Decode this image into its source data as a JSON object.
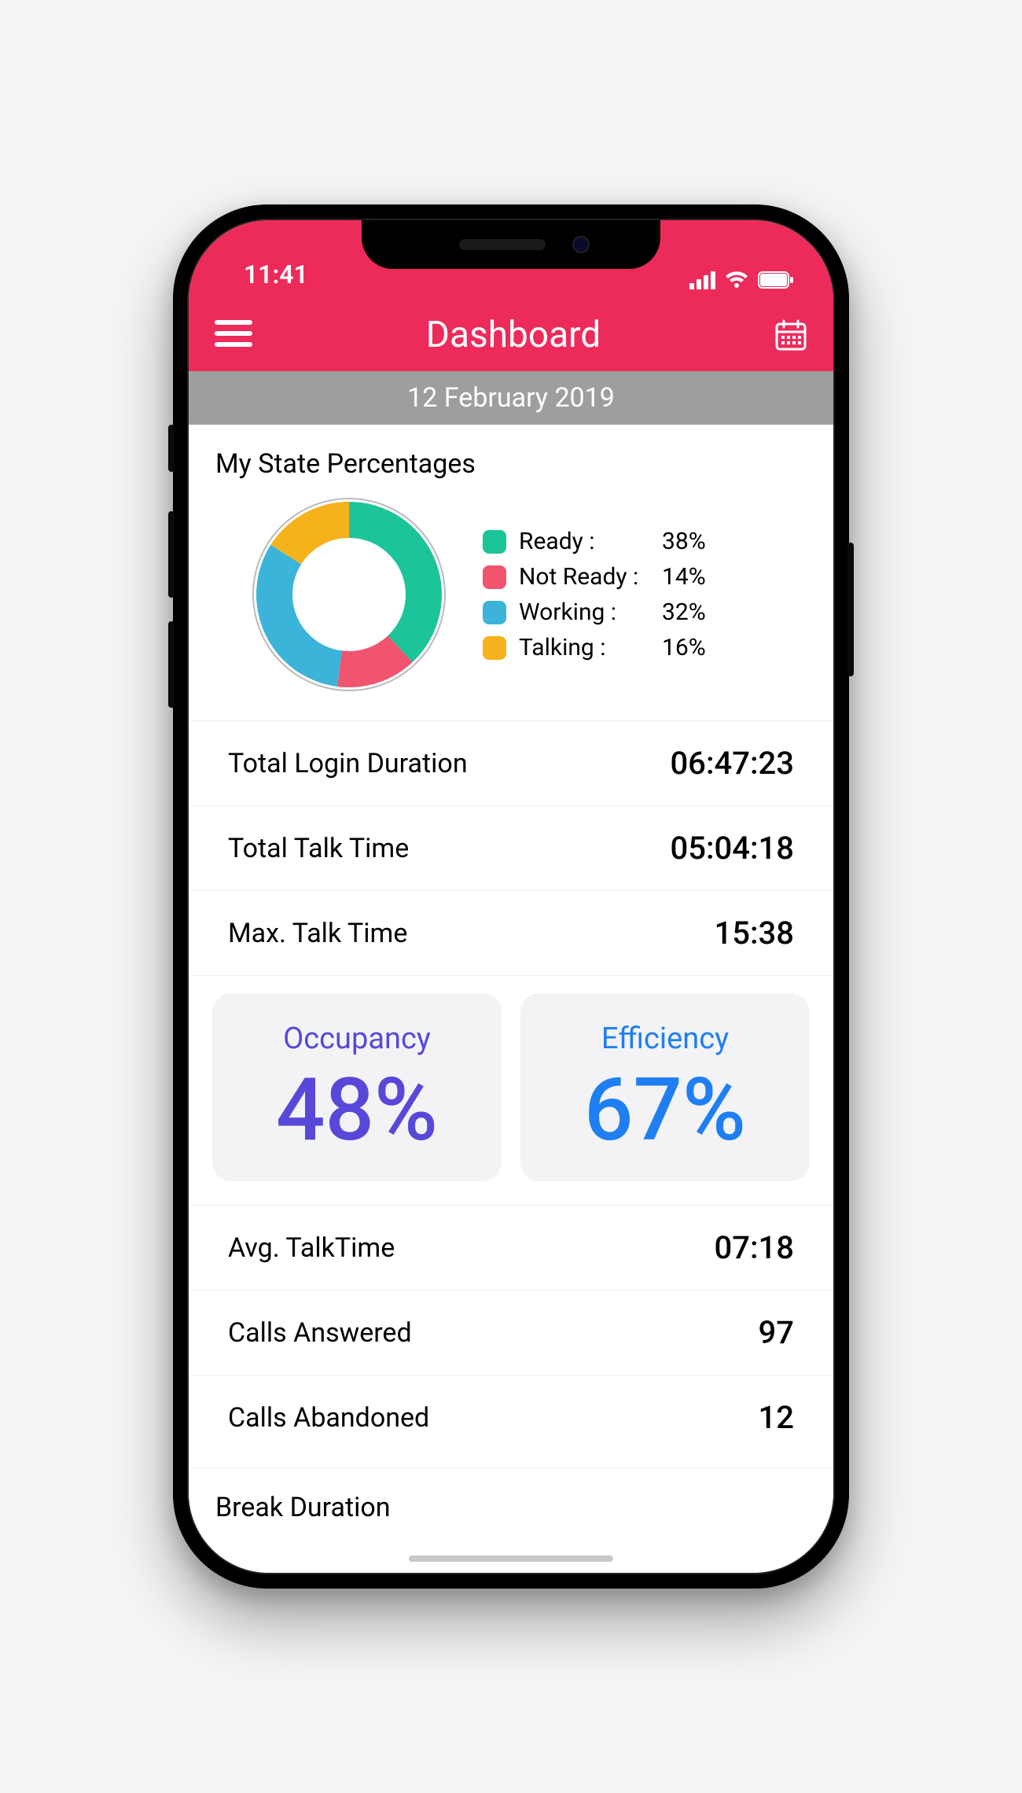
{
  "status": {
    "time": "11:41"
  },
  "header": {
    "title": "Dashboard"
  },
  "date_bar": "12 February 2019",
  "state_section": {
    "title": "My State Percentages",
    "legend": [
      {
        "label": "Ready :",
        "value": "38%",
        "color": "#1cc49a"
      },
      {
        "label": "Not Ready :",
        "value": "14%",
        "color": "#f0546e"
      },
      {
        "label": "Working :",
        "value": "32%",
        "color": "#3cb4d9"
      },
      {
        "label": "Talking :",
        "value": "16%",
        "color": "#f6b21b"
      }
    ]
  },
  "top_stats": [
    {
      "label": "Total Login Duration",
      "value": "06:47:23"
    },
    {
      "label": "Total Talk Time",
      "value": "05:04:18"
    },
    {
      "label": "Max. Talk Time",
      "value": "15:38"
    }
  ],
  "cards": {
    "occupancy": {
      "title": "Occupancy",
      "value": "48%"
    },
    "efficiency": {
      "title": "Efficiency",
      "value": "67%"
    }
  },
  "bottom_stats": [
    {
      "label": "Avg. TalkTime",
      "value": "07:18"
    },
    {
      "label": "Calls Answered",
      "value": "97"
    },
    {
      "label": "Calls Abandoned",
      "value": "12"
    }
  ],
  "break_section_title": "Break Duration",
  "chart_data": {
    "type": "pie",
    "title": "My State Percentages",
    "series": [
      {
        "name": "Ready",
        "value": 38,
        "color": "#1cc49a"
      },
      {
        "name": "Not Ready",
        "value": 14,
        "color": "#f0546e"
      },
      {
        "name": "Working",
        "value": 32,
        "color": "#3cb4d9"
      },
      {
        "name": "Talking",
        "value": 16,
        "color": "#f6b21b"
      }
    ]
  }
}
